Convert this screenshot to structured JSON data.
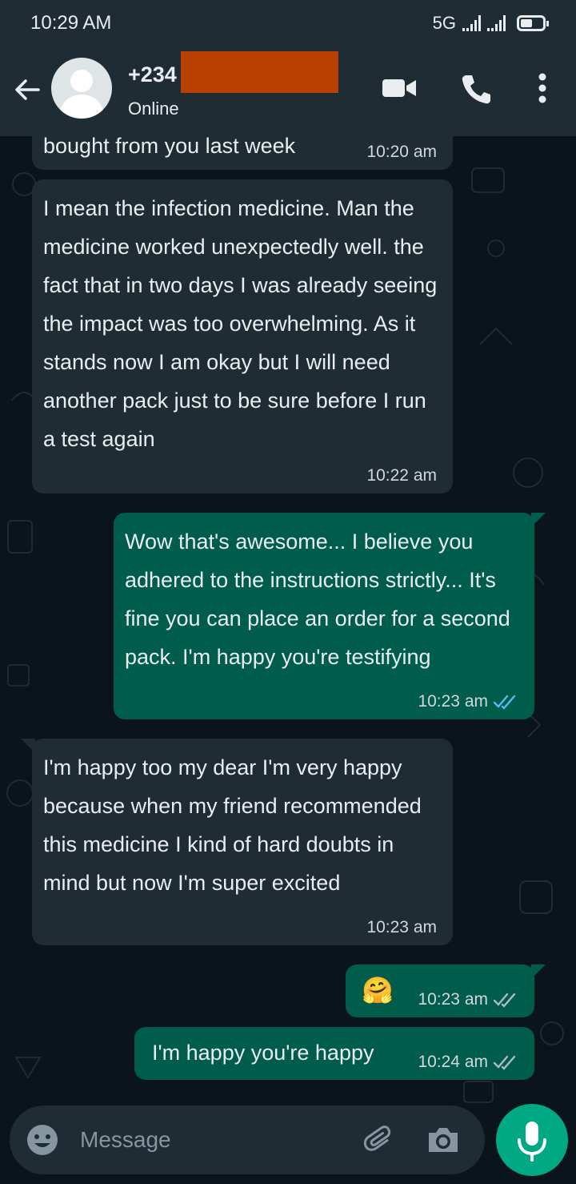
{
  "status_bar": {
    "time": "10:29 AM",
    "network": "5G",
    "icons": [
      "signal-icon",
      "signal-icon",
      "battery-icon"
    ]
  },
  "header": {
    "contact_prefix": "+234",
    "status": "Online",
    "icons": [
      "back-arrow-icon",
      "avatar-placeholder-icon",
      "video-call-icon",
      "voice-call-icon",
      "more-options-icon"
    ]
  },
  "messages": [
    {
      "direction": "in",
      "text": "bought from you last week",
      "time": "10:20 am"
    },
    {
      "direction": "in",
      "text": "I mean the infection medicine. Man the medicine worked unexpectedly well. the fact that in two days I was already seeing the impact was too overwhelming. As it stands now I am okay but I will need another pack just to be sure before I run a test again",
      "time": "10:22 am"
    },
    {
      "direction": "out",
      "text": "Wow that's awesome... I believe you adhered to the instructions strictly... It's fine you can place an order for a second pack. I'm happy you're testifying",
      "time": "10:23 am",
      "ticks": "read"
    },
    {
      "direction": "in",
      "text": "I'm happy too my dear I'm very happy because when my friend recommended this medicine I kind of hard doubts in mind but now I'm super excited",
      "time": "10:23 am"
    },
    {
      "direction": "out",
      "text": "🤗",
      "time": "10:23 am",
      "ticks": "delivered"
    },
    {
      "direction": "out",
      "text": "I'm happy you're happy",
      "time": "10:24 am",
      "ticks": "delivered"
    }
  ],
  "composer": {
    "placeholder": "Message",
    "icons": [
      "emoji-icon",
      "attach-icon",
      "camera-icon",
      "mic-icon"
    ]
  },
  "colors": {
    "background": "#0b141a",
    "header": "#1f2c34",
    "incoming_bubble": "#1f2c34",
    "outgoing_bubble": "#005c4b",
    "accent": "#00a884",
    "read_tick": "#53bdeb",
    "redaction": "#b84000"
  }
}
